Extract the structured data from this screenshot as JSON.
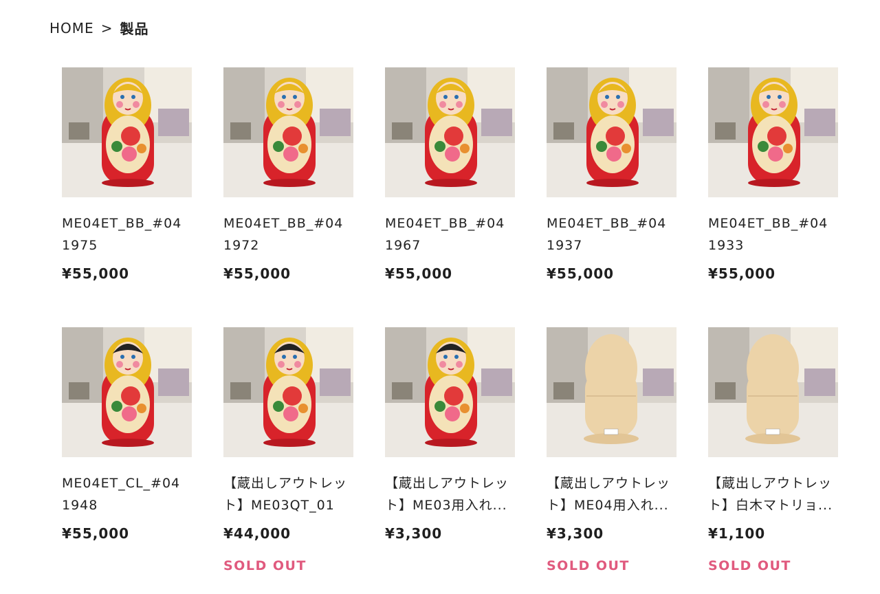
{
  "breadcrumb": {
    "home": "HOME",
    "separator": ">",
    "current": "製品"
  },
  "products": [
    {
      "title": "ME04ET_BB_#04 1975",
      "price": "¥55,000",
      "sold_out": "",
      "doll": "painted",
      "hair": "gold"
    },
    {
      "title": "ME04ET_BB_#04 1972",
      "price": "¥55,000",
      "sold_out": "",
      "doll": "painted",
      "hair": "gold"
    },
    {
      "title": "ME04ET_BB_#04 1967",
      "price": "¥55,000",
      "sold_out": "",
      "doll": "painted",
      "hair": "gold"
    },
    {
      "title": "ME04ET_BB_#04 1937",
      "price": "¥55,000",
      "sold_out": "",
      "doll": "painted",
      "hair": "gold"
    },
    {
      "title": "ME04ET_BB_#04 1933",
      "price": "¥55,000",
      "sold_out": "",
      "doll": "painted",
      "hair": "gold"
    },
    {
      "title": "ME04ET_CL_#04 1948",
      "price": "¥55,000",
      "sold_out": "",
      "doll": "painted",
      "hair": "dark"
    },
    {
      "title": "【蔵出しアウトレット】ME03QT_01",
      "price": "¥44,000",
      "sold_out": "SOLD OUT",
      "doll": "painted",
      "hair": "dark"
    },
    {
      "title": "【蔵出しアウトレット】ME03用入れ...",
      "price": "¥3,300",
      "sold_out": "",
      "doll": "painted",
      "hair": "dark"
    },
    {
      "title": "【蔵出しアウトレット】ME04用入れ...",
      "price": "¥3,300",
      "sold_out": "SOLD OUT",
      "doll": "blank",
      "hair": ""
    },
    {
      "title": "【蔵出しアウトレット】白木マトリョ...",
      "price": "¥1,100",
      "sold_out": "SOLD OUT",
      "doll": "blank",
      "hair": ""
    }
  ],
  "colors": {
    "sold_out": "#e05a7e",
    "doll_red": "#d8232a",
    "doll_gold": "#e8b820",
    "wood": "#ecd3a8"
  }
}
